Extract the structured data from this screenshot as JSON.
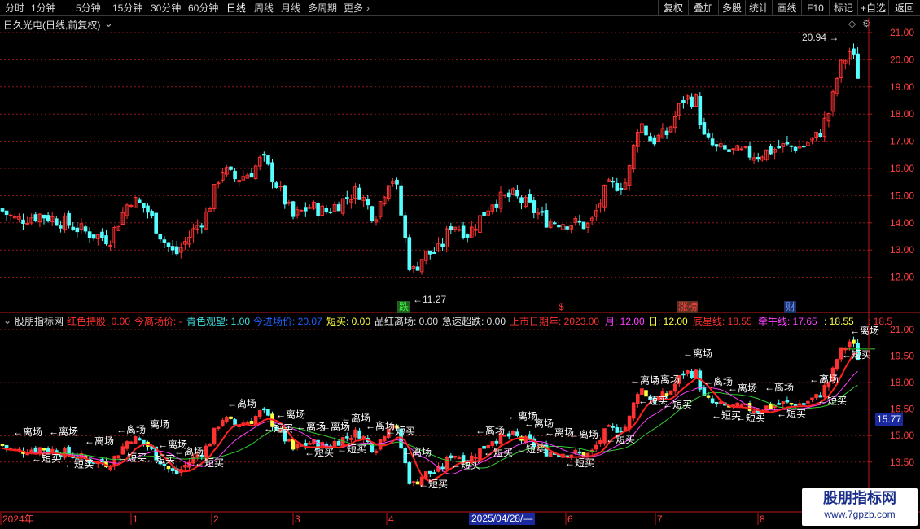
{
  "toolbar": {
    "periods": [
      "分时",
      "1分钟",
      "5分钟",
      "15分钟",
      "30分钟",
      "60分钟",
      "日线",
      "周线",
      "月线",
      "多周期",
      "更多"
    ],
    "active_period": "日线",
    "buttons": [
      "复权",
      "叠加",
      "多股",
      "统计",
      "画线",
      "F10",
      "+自选",
      "返回"
    ],
    "more_chevron_icon": "chevron-right-icon"
  },
  "main_pane": {
    "title": "日久光电(日线,前复权)",
    "collapse_icon": "chevron-down-icon",
    "y_ticks": [
      "21.00",
      "20.00",
      "19.00",
      "18.00",
      "17.00",
      "16.00",
      "15.00",
      "14.00",
      "13.00",
      "12.00"
    ],
    "high_label": "20.94",
    "low_label": "11.27",
    "event_labels": [
      "跌",
      "$",
      "涨榜",
      "财"
    ],
    "diamond_icon": "diamond-icon",
    "settings_icon": "gear-icon"
  },
  "indicator_pane": {
    "name": "股朋指标网",
    "items": [
      {
        "text": "红色持股: 0.00",
        "color": "#ff3030"
      },
      {
        "text": "今离场价: -",
        "color": "#ff3030"
      },
      {
        "text": "青色观望: 1.00",
        "color": "#40e0e0"
      },
      {
        "text": "今进场价: 20.07",
        "color": "#2060ff"
      },
      {
        "text": "短买: 0.00",
        "color": "#ffff40"
      },
      {
        "text": "品红离场: 0.00",
        "color": "#e0e0e0"
      },
      {
        "text": "急速超跌: 0.00",
        "color": "#e0e0e0"
      },
      {
        "text": "上市日期年: 2023.00",
        "color": "#ff3030"
      },
      {
        "text": "月: 12.00",
        "color": "#ff40ff"
      },
      {
        "text": "日: 12.00",
        "color": "#ffff40"
      },
      {
        "text": "底星线: 18.55",
        "color": "#ff3030"
      },
      {
        "text": "牵牛线: 17.65",
        "color": "#ff40ff"
      },
      {
        "text": ": 18.55",
        "color": "#ffff40"
      },
      {
        "text": ": 18.5",
        "color": "#ff3030"
      }
    ],
    "y_ticks": [
      "21.00",
      "19.50",
      "18.00",
      "16.50",
      "15.00",
      "13.50"
    ],
    "price_tag": "15.77",
    "signal_leave": "←离场",
    "signal_buy": "←短买"
  },
  "x_axis": {
    "labels": [
      "2024年",
      "1",
      "2",
      "3",
      "4",
      "6",
      "7",
      "8"
    ],
    "cursor_date": "2025/04/28/—"
  },
  "watermark": {
    "title": "股朋指标网",
    "url": "www.7gpzb.com"
  },
  "colors": {
    "up": "#ff3232",
    "down": "#54ffff",
    "grid": "#8a1a1a",
    "axis": "#c01818",
    "toolbar_bg": "#000000"
  },
  "chart_data": {
    "type": "candlestick",
    "x": [
      "2024-12",
      "2025-01",
      "2025-02",
      "2025-03",
      "2025-04",
      "2025-05",
      "2025-06",
      "2025-07",
      "2025-08"
    ],
    "close": [
      14.5,
      14.3,
      13.4,
      15.5,
      14.0,
      15.5,
      14.4,
      17.3,
      16.6,
      19.2
    ],
    "ylim": [
      11.5,
      21.3
    ],
    "high": 20.94,
    "low": 11.27
  }
}
